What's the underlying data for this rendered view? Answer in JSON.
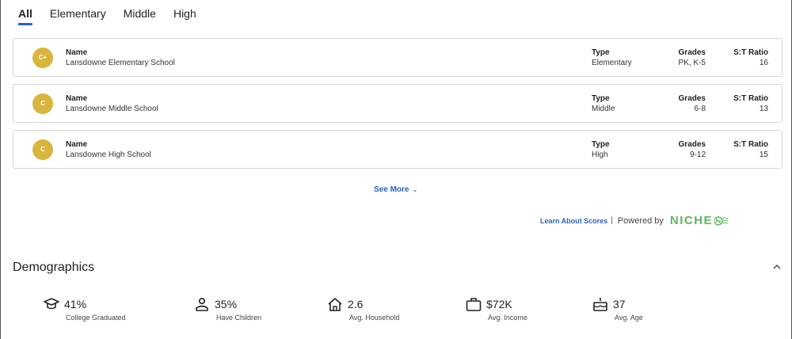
{
  "tabs": [
    {
      "label": "All",
      "active": true
    },
    {
      "label": "Elementary",
      "active": false
    },
    {
      "label": "Middle",
      "active": false
    },
    {
      "label": "High",
      "active": false
    }
  ],
  "columns": {
    "name": "Name",
    "type": "Type",
    "grades": "Grades",
    "ratio": "S:T Ratio"
  },
  "schools": [
    {
      "grade": "C+",
      "name": "Lansdowne Elementary School",
      "type": "Elementary",
      "grades": "PK, K-5",
      "ratio": "16"
    },
    {
      "grade": "C",
      "name": "Lansdowne Middle School",
      "type": "Middle",
      "grades": "6-8",
      "ratio": "13"
    },
    {
      "grade": "C",
      "name": "Lansdowne High School",
      "type": "High",
      "grades": "9-12",
      "ratio": "15"
    }
  ],
  "see_more": "See More",
  "footer": {
    "learn": "Learn About Scores",
    "separator": "|",
    "powered_by": "Powered by",
    "brand": "NICHE"
  },
  "demographics": {
    "title": "Demographics",
    "stats": [
      {
        "value": "41%",
        "caption": "College Graduated",
        "icon": "graduation-cap-icon"
      },
      {
        "value": "35%",
        "caption": "Have Children",
        "icon": "person-icon"
      },
      {
        "value": "2.6",
        "caption": "Avg. Household",
        "icon": "house-icon"
      },
      {
        "value": "$72K",
        "caption": "Avg. Income",
        "icon": "briefcase-icon"
      },
      {
        "value": "37",
        "caption": "Avg. Age",
        "icon": "cake-icon"
      }
    ]
  },
  "colors": {
    "accent": "#2b62c9",
    "badge": "#d9b53e",
    "brand": "#5cb85c"
  }
}
